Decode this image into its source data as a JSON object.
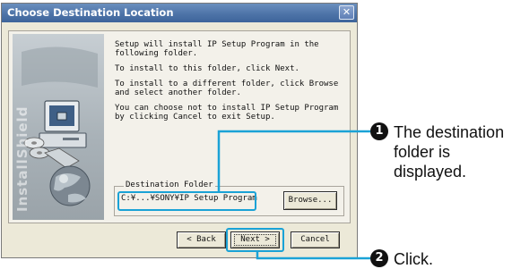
{
  "window": {
    "title": "Choose Destination Location"
  },
  "art": {
    "brand_text": "InstallShield"
  },
  "body": {
    "para1": "Setup will install IP Setup Program in the following folder.",
    "para2": "To install to this folder, click Next.",
    "para3": "To install to a different folder, click Browse and select another folder.",
    "para4": "You can choose not to install IP Setup Program by clicking Cancel to exit Setup."
  },
  "destination": {
    "legend": "Destination Folder",
    "path": "C:¥...¥SONY¥IP Setup Program",
    "browse_label": "Browse..."
  },
  "buttons": {
    "back_label": "< Back",
    "next_label": "Next >",
    "cancel_label": "Cancel"
  },
  "callouts": [
    {
      "number": "1",
      "text": "The destination folder is displayed."
    },
    {
      "number": "2",
      "text": "Click."
    }
  ],
  "colors": {
    "highlight": "#1aa2d6",
    "titlebar": "#4e74a8",
    "dialog_bg": "#ece9d8"
  }
}
